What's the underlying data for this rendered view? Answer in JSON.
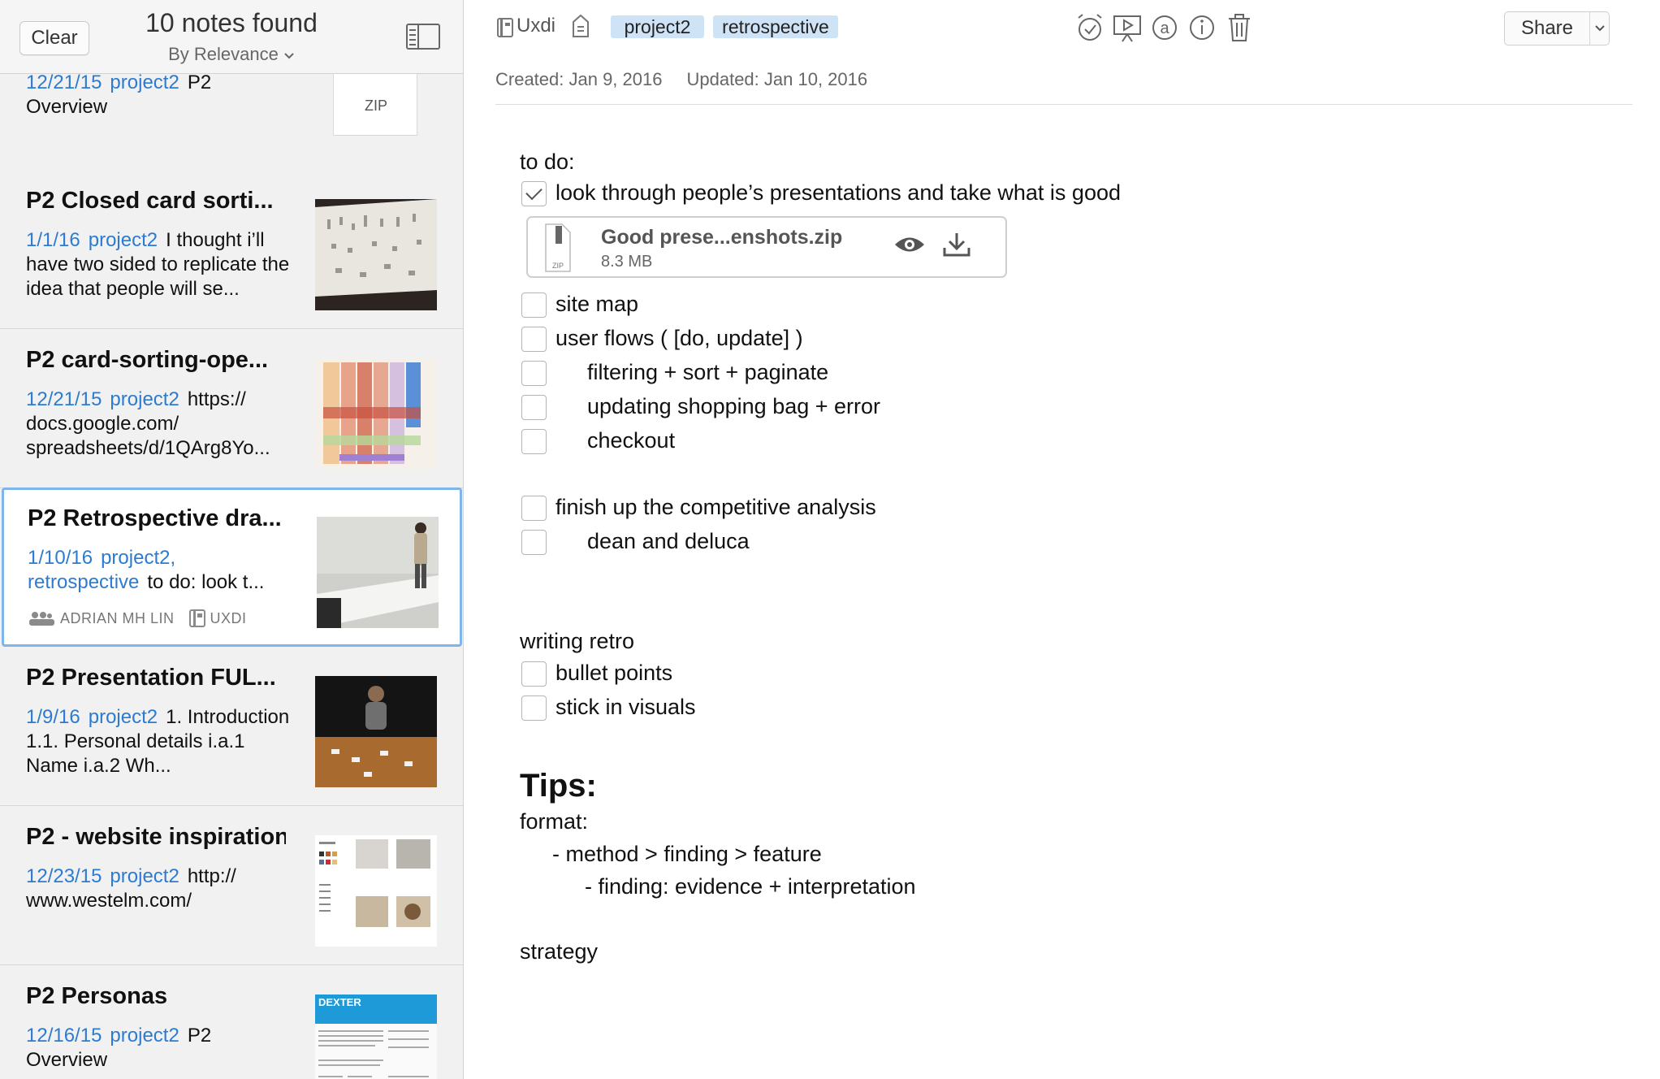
{
  "list": {
    "clear_label": "Clear",
    "count_label": "10 notes found",
    "sort_label": "By Relevance",
    "notes": [
      {
        "title": "",
        "date": "12/21/15",
        "tags": "project2",
        "snippet": "P2 Overview",
        "thumb": "zip",
        "thumb_label": "ZIP"
      },
      {
        "title": "P2 Closed card sorti...",
        "date": "1/1/16",
        "tags": "project2",
        "snippet": "I thought i’ll have two sided to replicate the idea that people will se...",
        "thumb": "paper-photo"
      },
      {
        "title": "P2 card-sorting-ope...",
        "date": "12/21/15",
        "tags": "project2",
        "snippet": "https:// docs.google.com/ spreadsheets/d/1QArg8Yo...",
        "thumb": "spreadsheet"
      },
      {
        "title": "P2 Retrospective dra...",
        "date": "1/10/16",
        "tags": "project2, retrospective",
        "snippet": "to do: look t...",
        "author": "ADRIAN MH LIN",
        "notebook": "UXDI",
        "thumb": "whiteboard-photo",
        "selected": true
      },
      {
        "title": "P2 Presentation FUL...",
        "date": "1/9/16",
        "tags": "project2",
        "snippet": "1. Introduction 1.1. Personal details i.a.1 Name i.a.2 Wh...",
        "thumb": "table-photo"
      },
      {
        "title": "P2 - website inspiration",
        "date": "12/23/15",
        "tags": "project2",
        "snippet": "http:// www.westelm.com/",
        "thumb": "website"
      },
      {
        "title": "P2 Personas",
        "date": "12/16/15",
        "tags": "project2",
        "snippet": "P2 Overview",
        "thumb": "persona",
        "thumb_label": "DEXTER"
      }
    ]
  },
  "editor": {
    "notebook": "Uxdi",
    "tags": [
      "project2",
      "retrospective"
    ],
    "share_label": "Share",
    "created": "Created: Jan 9, 2016",
    "updated": "Updated: Jan 10, 2016",
    "todo_heading": "to do:",
    "attachment": {
      "name": "Good prese...enshots.zip",
      "size": "8.3 MB",
      "type_label": "ZIP"
    },
    "checklist_1": [
      {
        "label": "look through people’s presentations and take what is good",
        "checked": true
      },
      {
        "label": "site map",
        "checked": false
      },
      {
        "label": "user flows ( [do, update] )",
        "checked": false
      },
      {
        "label": "filtering + sort + paginate",
        "checked": false
      },
      {
        "label": "updating shopping bag + error",
        "checked": false
      },
      {
        "label": "checkout",
        "checked": false
      },
      {
        "label": "finish up the competitive analysis",
        "checked": false
      },
      {
        "label": "dean and deluca",
        "checked": false
      }
    ],
    "writing_heading": "writing retro",
    "checklist_2": [
      {
        "label": "bullet points",
        "checked": false
      },
      {
        "label": "stick in visuals",
        "checked": false
      }
    ],
    "tips_heading": "Tips:",
    "format_label": "format:",
    "format_line_1": "- method > finding > feature",
    "format_line_2": "- finding: evidence + interpretation",
    "strategy_label": "strategy"
  },
  "colors": {
    "tag_bg": "#cfe3f7",
    "link_blue": "#2d7bd0",
    "selection_border": "#7eb6ec"
  },
  "icons": [
    "layout-toggle-icon",
    "notebook-icon",
    "reminder-icon",
    "alarm-icon",
    "presentation-icon",
    "mention-icon",
    "info-icon",
    "trash-icon",
    "chevron-down-icon",
    "zip-file-icon",
    "eye-icon",
    "download-icon",
    "shared-users-icon"
  ]
}
